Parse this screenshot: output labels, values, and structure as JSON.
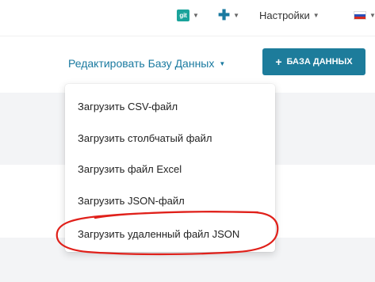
{
  "topnav": {
    "git": {
      "badge": "git",
      "icon": "chevron-down-icon"
    },
    "add": {
      "icon": "plus-icon"
    },
    "settings": {
      "label": "Настройки",
      "icon": "chevron-down-icon"
    },
    "language": {
      "icon": "ru-flag-icon"
    }
  },
  "toolbar": {
    "edit_db_label": "Редактировать Базу Данных",
    "db_button_label": "БАЗА ДАННЫХ"
  },
  "dropdown": {
    "items": [
      {
        "label": "Загрузить CSV-файл"
      },
      {
        "label": "Загрузить столбчатый файл"
      },
      {
        "label": "Загрузить файл Excel"
      },
      {
        "label": "Загрузить JSON-файл"
      },
      {
        "label": "Загрузить удаленный файл JSON"
      }
    ]
  },
  "colors": {
    "accent": "#1d7c9b",
    "link": "#1a7aa0",
    "git_badge": "#1aa39b",
    "annotation": "#e0201a"
  }
}
